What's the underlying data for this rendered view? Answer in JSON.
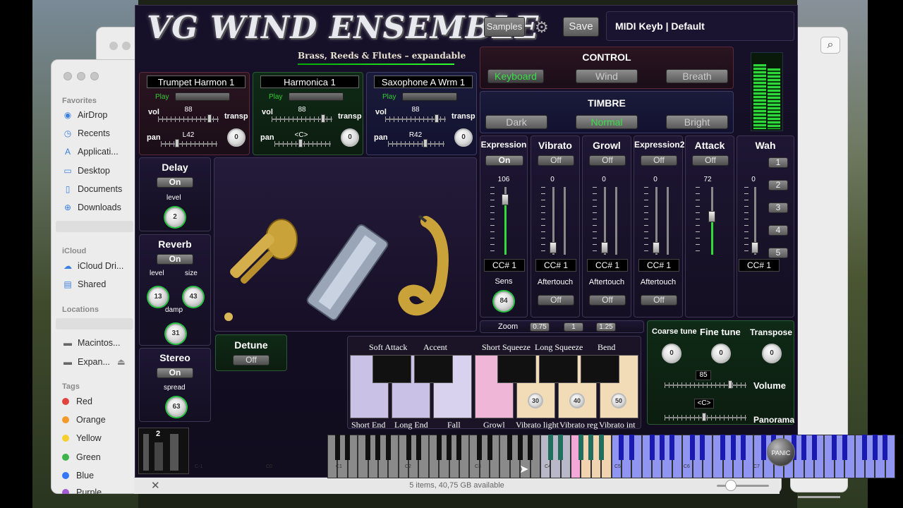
{
  "finder": {
    "favorites_header": "Favorites",
    "favorites": [
      "AirDrop",
      "Recents",
      "Applicati...",
      "Desktop",
      "Documents",
      "Downloads"
    ],
    "icloud_header": "iCloud",
    "icloud": [
      "iCloud Dri...",
      "Shared"
    ],
    "locations_header": "Locations",
    "locations": [
      "Macintos...",
      "Expan..."
    ],
    "tags_header": "Tags",
    "tags": [
      {
        "label": "Red",
        "color": "#e0443e"
      },
      {
        "label": "Orange",
        "color": "#f39a2b"
      },
      {
        "label": "Yellow",
        "color": "#f5cf2f"
      },
      {
        "label": "Green",
        "color": "#3cb449"
      },
      {
        "label": "Blue",
        "color": "#3478f6"
      },
      {
        "label": "Purple",
        "color": "#a35ad0"
      }
    ],
    "status": "5 items, 40,75 GB available"
  },
  "plugin": {
    "title": "VG WIND ENSEMBLE",
    "subtitle": "Brass, Reeds & Flutes – expandable",
    "samples_btn": "Samples",
    "save_btn": "Save",
    "preset": "MIDI Keyb | Default",
    "control": {
      "title": "CONTROL",
      "options": [
        "Keyboard",
        "Wind",
        "Breath"
      ],
      "selected": "Keyboard"
    },
    "timbre": {
      "title": "TIMBRE",
      "options": [
        "Dark",
        "Normal",
        "Bright"
      ],
      "selected": "Normal"
    },
    "instruments": [
      {
        "name": "Trumpet Harmon 1",
        "play": "Play",
        "vol_label": "vol",
        "vol": "88",
        "pan_label": "pan",
        "pan": "L42",
        "transp_label": "transp",
        "transp": "0"
      },
      {
        "name": "Harmonica 1",
        "play": "Play",
        "vol_label": "vol",
        "vol": "88",
        "pan_label": "pan",
        "pan": "<C>",
        "transp_label": "transp",
        "transp": "0"
      },
      {
        "name": "Saxophone A Wrm 1",
        "play": "Play",
        "vol_label": "vol",
        "vol": "88",
        "pan_label": "pan",
        "pan": "R42",
        "transp_label": "transp",
        "transp": "0"
      }
    ],
    "delay": {
      "title": "Delay",
      "state": "On",
      "level_label": "level",
      "level": "2"
    },
    "reverb": {
      "title": "Reverb",
      "state": "On",
      "level_label": "level",
      "level": "13",
      "size_label": "size",
      "size": "43",
      "damp_label": "damp",
      "damp": "31"
    },
    "stereo": {
      "title": "Stereo",
      "state": "On",
      "spread_label": "spread",
      "spread": "63"
    },
    "detune": {
      "title": "Detune",
      "state": "Off"
    },
    "modulators": [
      {
        "title": "Expression",
        "state": "On",
        "value": "106",
        "cc": "CC# 1",
        "sub": "Sens",
        "sens": "84"
      },
      {
        "title": "Vibrato",
        "state": "Off",
        "value": "0",
        "cc": "CC# 1",
        "sub": "Aftertouch",
        "sub_state": "Off"
      },
      {
        "title": "Growl",
        "state": "Off",
        "value": "0",
        "cc": "CC# 1",
        "sub": "Aftertouch",
        "sub_state": "Off"
      },
      {
        "title": "Expression2",
        "state": "Off",
        "value": "0",
        "cc": "CC# 1",
        "sub": "Aftertouch",
        "sub_state": "Off"
      },
      {
        "title": "Attack",
        "state": "Off",
        "value": "72"
      },
      {
        "title": "Wah",
        "value": "0",
        "cc": "CC# 1",
        "buttons": [
          "1",
          "2",
          "3",
          "4",
          "5"
        ]
      }
    ],
    "zoom": {
      "label": "Zoom",
      "options": [
        "0.75",
        "1",
        "1.25"
      ]
    },
    "tuning": {
      "coarse_label": "Coarse tune",
      "coarse": "0",
      "fine_label": "Fine tune",
      "fine": "0",
      "transpose_label": "Transpose",
      "transpose": "0",
      "volume_label": "Volume",
      "volume": "85",
      "panorama_label": "Panorama",
      "panorama": "<C>"
    },
    "articulations_top": [
      "Soft Attack",
      "Accent",
      "Short Squeeze",
      "Long Squeeze",
      "Bend"
    ],
    "articulations_bottom": [
      "Short End",
      "Long End",
      "Fall",
      "Growl",
      "Vibrato light",
      "Vibrato reg",
      "Vibrato int"
    ],
    "vibrato_knobs": [
      "30",
      "40",
      "50"
    ],
    "octave": "2",
    "key_labels": [
      "C-1",
      "C0",
      "C1",
      "C2",
      "C3",
      "C4",
      "C5",
      "C6",
      "C7"
    ],
    "panic": "PANIC"
  }
}
